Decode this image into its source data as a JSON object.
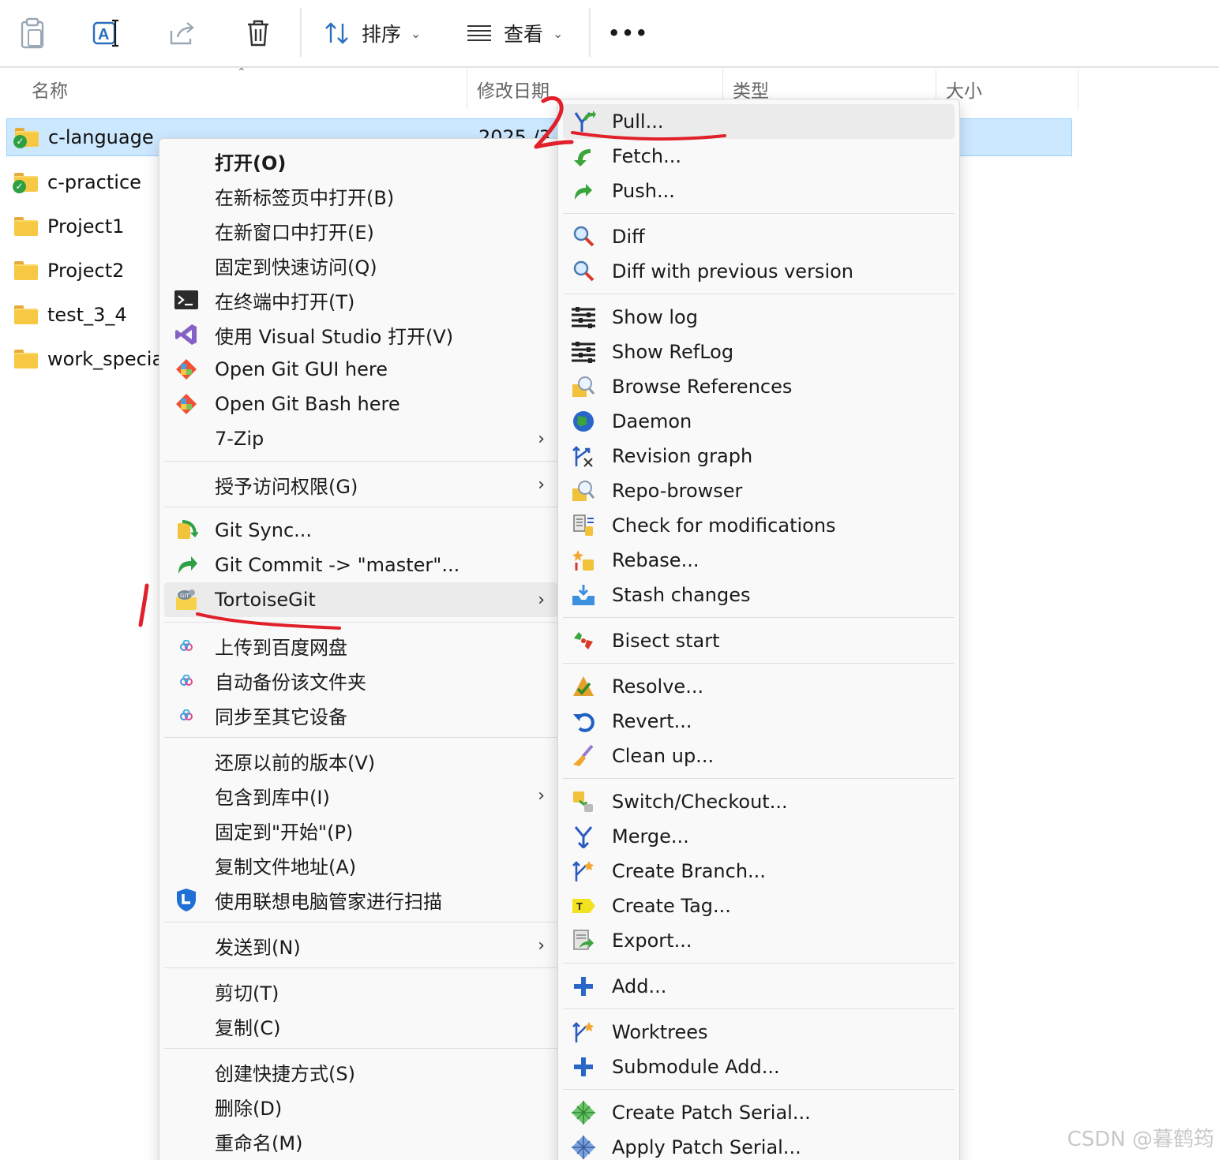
{
  "toolbar": {
    "sort_label": "排序",
    "view_label": "查看",
    "more_label": "•••"
  },
  "columns": {
    "name": "名称",
    "modified": "修改日期",
    "type": "类型",
    "size": "大小"
  },
  "files": [
    {
      "name": "c-language",
      "date": "2025 /3 /",
      "status": "git-ok",
      "selected": true
    },
    {
      "name": "c-practice",
      "status": "git-ok"
    },
    {
      "name": "Project1"
    },
    {
      "name": "Project2"
    },
    {
      "name": "test_3_4"
    },
    {
      "name": "work_special"
    }
  ],
  "context_menu": {
    "items": [
      {
        "label": "打开(O)"
      },
      {
        "label": "在新标签页中打开(B)"
      },
      {
        "label": "在新窗口中打开(E)"
      },
      {
        "label": "固定到快速访问(Q)"
      },
      {
        "label": "在终端中打开(T)",
        "icon": "terminal-icon"
      },
      {
        "label": "使用 Visual Studio 打开(V)",
        "icon": "visual-studio-icon"
      },
      {
        "label": "Open Git GUI here",
        "icon": "git-gui-icon"
      },
      {
        "label": "Open Git Bash here",
        "icon": "git-bash-icon"
      },
      {
        "label": "7-Zip",
        "arrow": "›"
      },
      {
        "label": "授予访问权限(G)",
        "arrow": "›"
      },
      {
        "label": "Git Sync...",
        "icon": "git-sync-icon"
      },
      {
        "label": "Git Commit -> \"master\"...",
        "icon": "git-commit-icon"
      },
      {
        "label": "TortoiseGit",
        "icon": "tortoisegit-icon",
        "arrow": "›"
      },
      {
        "label": "上传到百度网盘",
        "icon": "baidu-netdisk-icon"
      },
      {
        "label": "自动备份该文件夹",
        "icon": "baidu-netdisk-icon"
      },
      {
        "label": "同步至其它设备",
        "icon": "baidu-netdisk-icon"
      },
      {
        "label": "还原以前的版本(V)"
      },
      {
        "label": "包含到库中(I)",
        "arrow": "›"
      },
      {
        "label": "固定到\"开始\"(P)"
      },
      {
        "label": "复制文件地址(A)"
      },
      {
        "label": "使用联想电脑管家进行扫描",
        "icon": "lenovo-shield-icon"
      },
      {
        "label": "发送到(N)",
        "arrow": "›"
      },
      {
        "label": "剪切(T)"
      },
      {
        "label": "复制(C)"
      },
      {
        "label": "创建快捷方式(S)"
      },
      {
        "label": "删除(D)"
      },
      {
        "label": "重命名(M)"
      }
    ]
  },
  "tortoise_menu": {
    "items": [
      {
        "label": "Pull...",
        "icon": "pull-icon"
      },
      {
        "label": "Fetch...",
        "icon": "fetch-icon"
      },
      {
        "label": "Push...",
        "icon": "push-icon"
      },
      {
        "label": "Diff",
        "icon": "diff-icon"
      },
      {
        "label": "Diff with previous version",
        "icon": "diff-icon"
      },
      {
        "label": "Show log",
        "icon": "log-icon"
      },
      {
        "label": "Show RefLog",
        "icon": "log-icon"
      },
      {
        "label": "Browse References",
        "icon": "browse-references-icon"
      },
      {
        "label": "Daemon",
        "icon": "globe-icon"
      },
      {
        "label": "Revision graph",
        "icon": "revision-graph-icon"
      },
      {
        "label": "Repo-browser",
        "icon": "repo-browser-icon"
      },
      {
        "label": "Check for modifications",
        "icon": "check-modifications-icon"
      },
      {
        "label": "Rebase...",
        "icon": "rebase-icon"
      },
      {
        "label": "Stash changes",
        "icon": "stash-icon"
      },
      {
        "label": "Bisect start",
        "icon": "bisect-icon"
      },
      {
        "label": "Resolve...",
        "icon": "resolve-icon"
      },
      {
        "label": "Revert...",
        "icon": "revert-icon"
      },
      {
        "label": "Clean up...",
        "icon": "cleanup-icon"
      },
      {
        "label": "Switch/Checkout...",
        "icon": "switch-icon"
      },
      {
        "label": "Merge...",
        "icon": "merge-icon"
      },
      {
        "label": "Create Branch...",
        "icon": "branch-icon"
      },
      {
        "label": "Create Tag...",
        "icon": "tag-icon"
      },
      {
        "label": "Export...",
        "icon": "export-icon"
      },
      {
        "label": "Add...",
        "icon": "add-icon"
      },
      {
        "label": "Worktrees",
        "icon": "worktree-icon"
      },
      {
        "label": "Submodule Add...",
        "icon": "add-icon"
      },
      {
        "label": "Create Patch Serial...",
        "icon": "patch-icon"
      },
      {
        "label": "Apply Patch Serial...",
        "icon": "apply-patch-icon"
      }
    ]
  },
  "annotations": {
    "mark_1": "1",
    "mark_2": "2"
  },
  "watermark": "CSDN @暮鹤筠",
  "colors": {
    "selection": "#cce8ff",
    "annotation": "#e0202a",
    "menu_bg": "#f9f9f9"
  }
}
